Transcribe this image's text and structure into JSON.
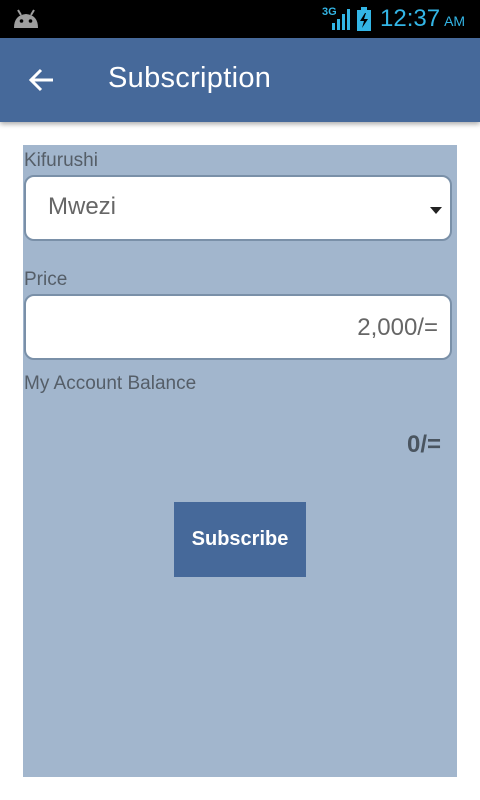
{
  "status_bar": {
    "network": "3G",
    "time": "12:37",
    "ampm": "AM",
    "icons": [
      "android-icon",
      "signal-icon",
      "battery-charging-icon"
    ]
  },
  "app_bar": {
    "title": "Subscription",
    "back_icon": "arrow-left-icon",
    "color": "#46699a"
  },
  "form": {
    "package_label": "Kifurushi",
    "package_value": "Mwezi",
    "price_label": "Price",
    "price_value": "2,000/=",
    "balance_label": "My Account Balance",
    "balance_value": "0/=",
    "subscribe_label": "Subscribe",
    "panel_color": "#a2b6cd"
  }
}
